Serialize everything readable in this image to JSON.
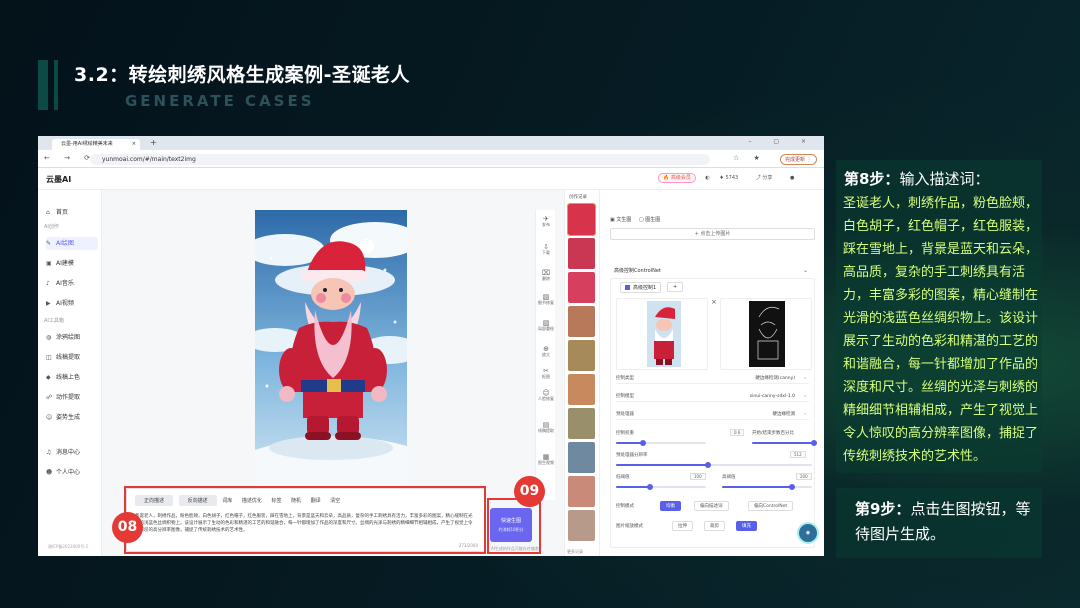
{
  "slide": {
    "title": "3.2：转绘刺绣风格生成案例-圣诞老人",
    "subtitle": "GENERATE CASES"
  },
  "browser": {
    "tab_title": "云墨-用AI绣绘精美未来",
    "tab_close": "×",
    "new_tab": "+",
    "window_controls": "– ▢ ×",
    "nav": "← → ⟳",
    "url": "yunmoai.com/#/main/text2img",
    "update_label": "完成更新 ⋮"
  },
  "app": {
    "logo": "云墨AI",
    "header": {
      "vip": "🔥 高级会员",
      "points": "5743",
      "share": "分享"
    },
    "sidebar": {
      "home": "首页",
      "group_ai": "AI创作",
      "ai_draw": "AI绘图",
      "ai_model": "AI建模",
      "ai_music": "AI音乐",
      "ai_video": "AI视频",
      "group_tools": "AI工具箱",
      "paint": "涂鸦绘图",
      "lineart": "线稿提取",
      "colorize": "线稿上色",
      "motion": "动作提取",
      "pose": "姿势生成",
      "messages": "消息中心",
      "profile": "个人中心",
      "footer": "湘ICP备2023000号-2"
    },
    "tools": [
      "发布",
      "下载",
      "删除",
      "细节修复",
      "局部重绘",
      "放大",
      "抠图",
      "人脸修复",
      "线稿提取",
      "图生视频"
    ],
    "prompt": {
      "tab_positive": "正向描述",
      "tab_negative": "反向描述",
      "tools": [
        "词库",
        "描述优化",
        "标签",
        "随机",
        "翻译",
        "清空"
      ],
      "text": "圣诞老人，刺绣作品，粉色脸颊，白色胡子，红色帽子，红色服装，踩在雪地上，背景是蓝天和云朵，高品质，复杂的手工刺绣具有活力，丰富多彩的图案，精心缝制在光滑的浅蓝色丝绸织物上。该设计展示了生动的色彩和精湛的工艺的和谐融合，每一针都增加了作品的深度和尺寸。丝绸的光泽与刺绣的精细细节相辅相成，产生了视觉上令人惊叹的高分辨率图像，捕捉了传统刺绣技术的艺术性。",
      "count": "273/2000"
    },
    "generate": {
      "label": "快速生图",
      "sub": "约消耗10积分",
      "hint": "AI生成的作品可能存在偏差"
    },
    "history": {
      "title": "创作记录",
      "more": "更多记录"
    },
    "panel": {
      "tab_text2img": "文生图",
      "tab_img2img": "图生图",
      "upload": "+ 点击上传图片",
      "controlnet_title": "高级控制ControlNet",
      "cn_tab": "高级控制1",
      "cn_add": "+",
      "rows": [
        {
          "label": "控制类型",
          "value": "硬边缘检测(canny)"
        },
        {
          "label": "控制模型",
          "value": "sinui-canny-sdxl-1.0"
        },
        {
          "label": "预处理器",
          "value": "硬边缘检测"
        }
      ],
      "sliders": [
        {
          "label": "控制权重",
          "value": "0.6",
          "fraction": 0.3
        },
        {
          "label": "开始/结束步数百分比",
          "value": "",
          "fraction": 1.0
        },
        {
          "label": "预处理器分辨率",
          "value": "512",
          "fraction": 0.47
        },
        {
          "label": "低阈值",
          "value": "100",
          "fraction": 0.38
        },
        {
          "label": "高阈值",
          "value": "200",
          "fraction": 0.78
        }
      ],
      "mode_label": "控制模式",
      "modes": [
        "均衡",
        "偏向描述词",
        "偏向ControlNet"
      ],
      "resize_label": "图片缩放模式",
      "resizes": [
        "拉伸",
        "裁剪",
        "填充"
      ]
    }
  },
  "annotations": {
    "badge_08": "08",
    "badge_09": "09"
  },
  "steps": {
    "step8_label": "第8步：",
    "step8_title": "输入描述词：",
    "step8_body": "圣诞老人，刺绣作品，粉色脸颊，白色胡子，红色帽子，红色服装，踩在雪地上，背景是蓝天和云朵，高品质，复杂的手工刺绣具有活力，丰富多彩的图案，精心缝制在光滑的浅蓝色丝绸织物上。该设计展示了生动的色彩和精湛的工艺的和谐融合，每一针都增加了作品的深度和尺寸。丝绸的光泽与刺绣的精细细节相辅相成，产生了视觉上令人惊叹的高分辨率图像，捕捉了传统刺绣技术的艺术性。",
    "step9_label": "第9步：",
    "step9_body": "点击生图按钮，等待图片生成。"
  },
  "colors": {
    "accent": "#5960e8",
    "highlight_red": "#e53935",
    "step_text": "#d6ff7a"
  }
}
